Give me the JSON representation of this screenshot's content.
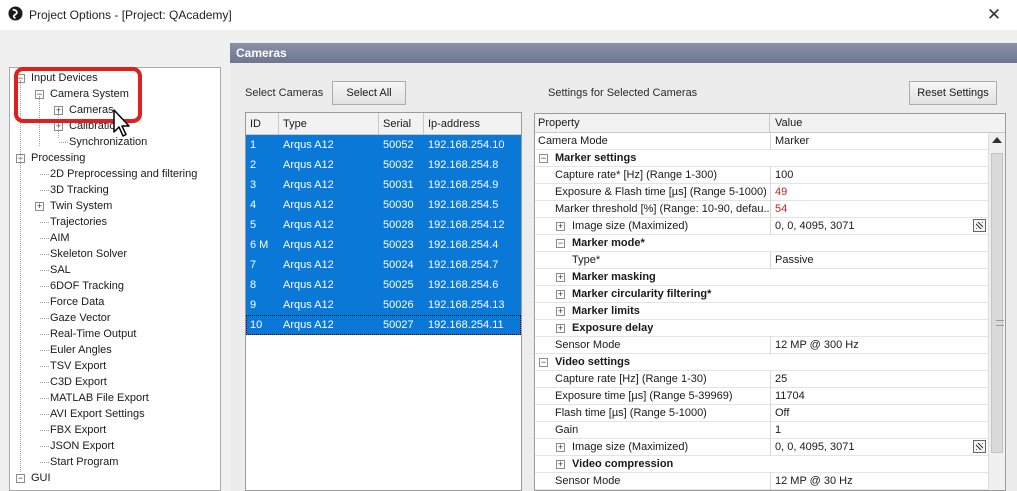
{
  "window": {
    "title": "Project Options - [Project: QAcademy]",
    "close_glyph": "✕"
  },
  "tree": {
    "items": [
      {
        "label": "Input Devices",
        "expander": "−"
      },
      {
        "label": "Camera System",
        "expander": "−"
      },
      {
        "label": "Cameras",
        "expander": "+"
      },
      {
        "label": "Calibration",
        "expander": "+"
      },
      {
        "label": "Synchronization"
      },
      {
        "label": "Processing",
        "expander": "−"
      },
      {
        "label": "2D Preprocessing and filtering"
      },
      {
        "label": "3D Tracking"
      },
      {
        "label": "Twin System",
        "expander": "+"
      },
      {
        "label": "Trajectories"
      },
      {
        "label": "AIM"
      },
      {
        "label": "Skeleton Solver"
      },
      {
        "label": "SAL"
      },
      {
        "label": "6DOF Tracking"
      },
      {
        "label": "Force Data"
      },
      {
        "label": "Gaze Vector"
      },
      {
        "label": "Real-Time Output"
      },
      {
        "label": "Euler Angles"
      },
      {
        "label": "TSV Export"
      },
      {
        "label": "C3D Export"
      },
      {
        "label": "MATLAB File Export"
      },
      {
        "label": "AVI Export Settings"
      },
      {
        "label": "FBX Export"
      },
      {
        "label": "JSON Export"
      },
      {
        "label": "Start Program"
      },
      {
        "label": "GUI",
        "expander": "−"
      }
    ]
  },
  "main": {
    "section_title": "Cameras",
    "select_cameras_label": "Select Cameras",
    "select_all_button": "Select All",
    "settings_label": "Settings for Selected Cameras",
    "reset_button": "Reset Settings"
  },
  "camera_table": {
    "columns": [
      "ID",
      "Type",
      "Serial",
      "Ip-address"
    ],
    "rows": [
      [
        "1",
        "Arqus A12",
        "50052",
        "192.168.254.10"
      ],
      [
        "2",
        "Arqus A12",
        "50032",
        "192.168.254.8"
      ],
      [
        "3",
        "Arqus A12",
        "50031",
        "192.168.254.9"
      ],
      [
        "4",
        "Arqus A12",
        "50030",
        "192.168.254.5"
      ],
      [
        "5",
        "Arqus A12",
        "50028",
        "192.168.254.12"
      ],
      [
        "6 M",
        "Arqus A12",
        "50023",
        "192.168.254.4"
      ],
      [
        "7",
        "Arqus A12",
        "50024",
        "192.168.254.7"
      ],
      [
        "8",
        "Arqus A12",
        "50025",
        "192.168.254.6"
      ],
      [
        "9",
        "Arqus A12",
        "50026",
        "192.168.254.13"
      ],
      [
        "10",
        "Arqus A12",
        "50027",
        "192.168.254.11"
      ]
    ]
  },
  "property_grid": {
    "columns": [
      "Property",
      "Value"
    ],
    "rows": [
      {
        "name": "Camera Mode",
        "value": "Marker",
        "level": 0
      },
      {
        "name": "Marker settings",
        "value": "",
        "level": 0,
        "cat": true,
        "expander": "−"
      },
      {
        "name": "Capture rate* [Hz] (Range 1-300)",
        "value": "100",
        "level": 1
      },
      {
        "name": "Exposure & Flash time [µs] (Range 5-1000)",
        "value": "49",
        "level": 1,
        "red": true
      },
      {
        "name": "Marker threshold [%] (Range: 10-90, defau...",
        "value": "54",
        "level": 1,
        "red": true
      },
      {
        "name": "Image size (Maximized)",
        "value": "0, 0, 4095, 3071",
        "level": 1,
        "expander": "+",
        "button": true
      },
      {
        "name": "Marker mode*",
        "value": "",
        "level": 1,
        "cat": true,
        "expander": "−"
      },
      {
        "name": "Type*",
        "value": "Passive",
        "level": 2
      },
      {
        "name": "Marker masking",
        "value": "",
        "level": 1,
        "cat": true,
        "expander": "+"
      },
      {
        "name": "Marker circularity filtering*",
        "value": "",
        "level": 1,
        "cat": true,
        "expander": "+"
      },
      {
        "name": "Marker limits",
        "value": "",
        "level": 1,
        "cat": true,
        "expander": "+"
      },
      {
        "name": "Exposure delay",
        "value": "",
        "level": 1,
        "cat": true,
        "expander": "+"
      },
      {
        "name": "Sensor Mode",
        "value": "12 MP @ 300 Hz",
        "level": 1
      },
      {
        "name": "Video settings",
        "value": "",
        "level": 0,
        "cat": true,
        "expander": "−"
      },
      {
        "name": "Capture rate [Hz] (Range 1-30)",
        "value": "25",
        "level": 1
      },
      {
        "name": "Exposure time [µs] (Range 5-39969)",
        "value": "11704",
        "level": 1
      },
      {
        "name": "Flash time [µs] (Range 5-1000)",
        "value": "Off",
        "level": 1
      },
      {
        "name": "Gain",
        "value": "1",
        "level": 1
      },
      {
        "name": "Image size (Maximized)",
        "value": "0, 0, 4095, 3071",
        "level": 1,
        "expander": "+",
        "button": true
      },
      {
        "name": "Video compression",
        "value": "",
        "level": 1,
        "cat": true,
        "expander": "+"
      },
      {
        "name": "Sensor Mode",
        "value": "12 MP @ 30 Hz",
        "level": 1
      }
    ]
  },
  "colors": {
    "selection": "#0a78d7",
    "highlight_ring": "#e01f1f",
    "warning_value": "#c8201f"
  }
}
